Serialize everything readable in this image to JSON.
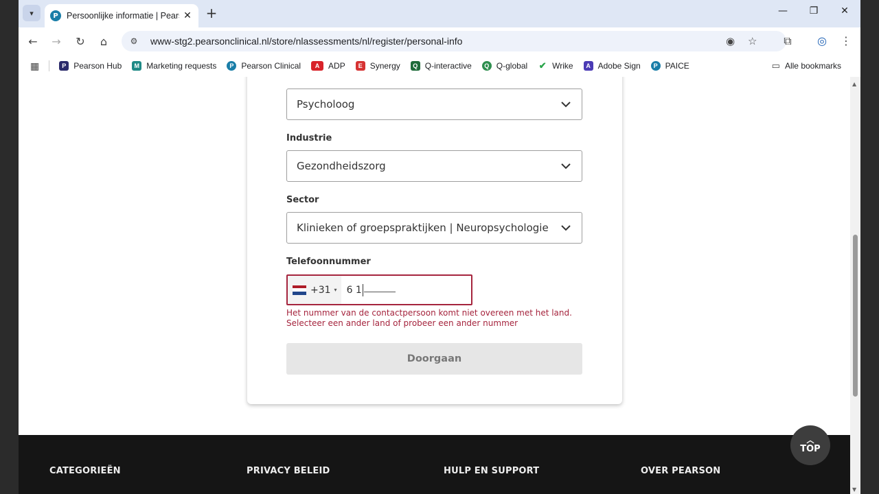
{
  "browser": {
    "tab_title": "Persoonlijke informatie | Pearson",
    "url": "www-stg2.pearsonclinical.nl/store/nlassessments/nl/register/personal-info",
    "bookmarks": [
      "Pearson Hub",
      "Marketing requests",
      "Pearson Clinical",
      "ADP",
      "Synergy",
      "Q-interactive",
      "Q-global",
      "Wrike",
      "Adobe Sign",
      "PAICE"
    ],
    "all_bookmarks": "Alle bookmarks"
  },
  "form": {
    "function_select": "Psycholoog",
    "industry_label": "Industrie",
    "industry_select": "Gezondheidszorg",
    "sector_label": "Sector",
    "sector_select": "Klinieken of groepspraktijken | Neuropsychologie",
    "phone_label": "Telefoonnummer",
    "phone_country_code": "+31",
    "phone_value": "6 1",
    "error_line1": "Het nummer van de contactpersoon komt niet overeen met het land.",
    "error_line2": "Selecteer een ander land of probeer een ander nummer",
    "continue_label": "Doorgaan"
  },
  "footer": {
    "col1": "CATEGORIEËN",
    "col2": "PRIVACY BELEID",
    "col3": "HULP EN SUPPORT",
    "col4": "OVER PEARSON",
    "top_label": "TOP"
  },
  "colors": {
    "error": "#a5243d",
    "footer_bg": "#151515"
  }
}
